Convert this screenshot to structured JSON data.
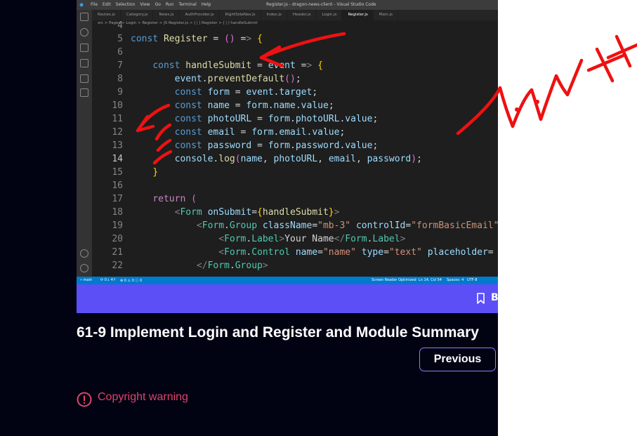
{
  "vscode": {
    "window_title": "Register.js - dragon-news-client - Visual Studio Code",
    "menu": [
      "File",
      "Edit",
      "Selection",
      "View",
      "Go",
      "Run",
      "Terminal",
      "Help"
    ],
    "tabs": [
      "Routes.js",
      "Category.js",
      "News.js",
      "AuthProvider.js",
      "RightSideNav.js",
      "Index.js",
      "Header.js",
      "Login.js",
      "Register.js",
      "Main.js"
    ],
    "active_tab": "Register.js",
    "breadcrumb": "src > Pages > Login > Register > JS Register.js > [❘] Register > [❘] handleSubmit",
    "status": {
      "branch": "⑂ main",
      "sync": "⟳ 0↓ 4↑",
      "problems": "⊗ 0 ⚠ 0 ⓘ 0",
      "reader": "Screen Reader Optimized",
      "position": "Ln 14, Col 54",
      "spaces": "Spaces: 4",
      "encoding": "UTF-8"
    },
    "lines": [
      {
        "n": "4",
        "t": ""
      },
      {
        "n": "5",
        "t": "const Register = () => {"
      },
      {
        "n": "6",
        "t": ""
      },
      {
        "n": "7",
        "t": "    const handleSubmit = event => {"
      },
      {
        "n": "8",
        "t": "        event.preventDefault();"
      },
      {
        "n": "9",
        "t": "        const form = event.target;"
      },
      {
        "n": "10",
        "t": "        const name = form.name.value;"
      },
      {
        "n": "11",
        "t": "        const photoURL = form.photoURL.value;"
      },
      {
        "n": "12",
        "t": "        const email = form.email.value;"
      },
      {
        "n": "13",
        "t": "        const password = form.password.value;"
      },
      {
        "n": "14",
        "t": "        console.log(name, photoURL, email, password);"
      },
      {
        "n": "15",
        "t": "    }"
      },
      {
        "n": "16",
        "t": ""
      },
      {
        "n": "17",
        "t": "    return ("
      },
      {
        "n": "18",
        "t": "        <Form onSubmit={handleSubmit}>"
      },
      {
        "n": "19",
        "t": "            <Form.Group className=\"mb-3\" controlId=\"formBasicEmail\">"
      },
      {
        "n": "20",
        "t": "                <Form.Label>Your Name</Form.Label>"
      },
      {
        "n": "21",
        "t": "                <Form.Control name=\"name\" type=\"text\" placeholder="
      },
      {
        "n": "22",
        "t": "            </Form.Group>"
      }
    ]
  },
  "banner": {
    "bookmark_letter": "B"
  },
  "lesson": {
    "title": "61-9 Implement Login and Register and Module Summary"
  },
  "nav": {
    "previous_label": "Previous"
  },
  "warning": {
    "label": "Copyright warning"
  },
  "colors": {
    "page_bg": "#010313",
    "banner": "#5b4ff5",
    "accent": "#8b7ff5",
    "warning": "#e0436b",
    "ink": "#ee1111"
  }
}
